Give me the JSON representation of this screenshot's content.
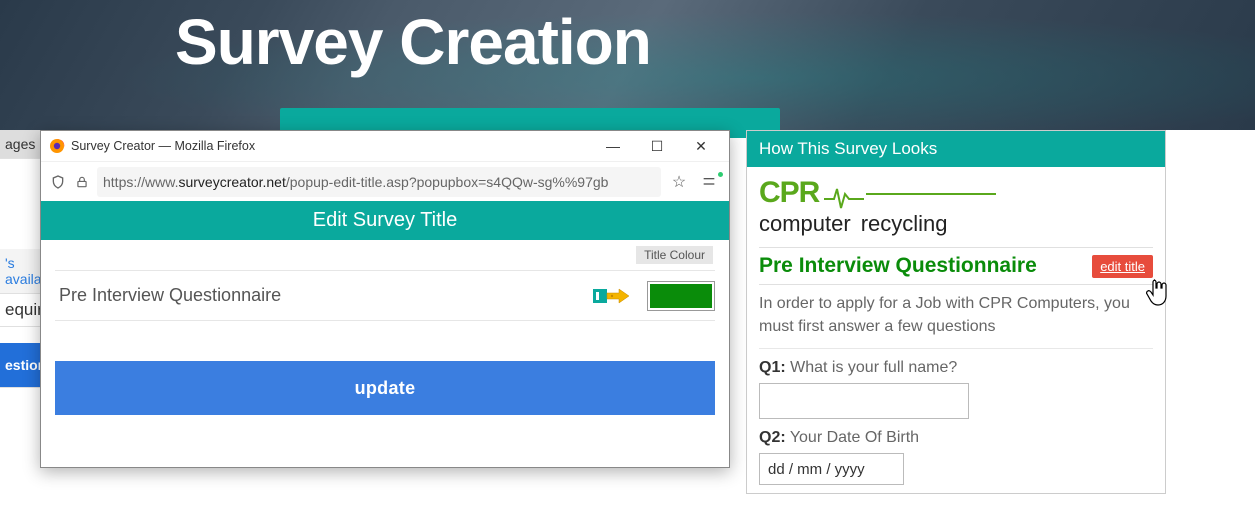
{
  "hero": {
    "title": "Survey Creation"
  },
  "sidebar": {
    "pages": "ages :",
    "avail": "'s availa",
    "required": "equire",
    "question": "estior"
  },
  "popup": {
    "windowTitle": "Survey Creator — Mozilla Firefox",
    "url_prefix": "https://www.",
    "url_host": "surveycreator.net",
    "url_rest": "/popup-edit-title.asp?popupbox=s4QQw-sg%%97gb",
    "header": "Edit Survey Title",
    "titleColourLabel": "Title Colour",
    "titleValue": "Pre Interview Questionnaire",
    "titleColour": "#0a8c0a",
    "updateLabel": "update"
  },
  "preview": {
    "header": "How This Survey Looks",
    "logo": {
      "cpr": "CPR",
      "sub1": "computer",
      "sub2": "recycling"
    },
    "surveyTitle": "Pre Interview Questionnaire",
    "editTitleLabel": "edit title",
    "intro": "In order to apply for a Job with CPR Computers, you must first answer a few questions",
    "q1": {
      "num": "Q1:",
      "text": " What is your full name?"
    },
    "q2": {
      "num": "Q2:",
      "text": " Your Date Of Birth"
    },
    "datePlaceholder": "dd / mm / yyyy"
  }
}
